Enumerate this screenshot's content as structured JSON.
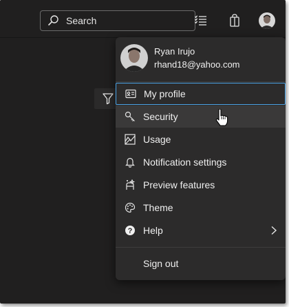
{
  "topbar": {
    "search_placeholder": "Search",
    "icons": [
      "search-icon",
      "list-icon",
      "bag-icon",
      "avatar"
    ]
  },
  "profile": {
    "name": "Ryan Irujo",
    "email": "rhand18@yahoo.com"
  },
  "menu": {
    "items": [
      {
        "label": "My profile",
        "icon": "contact-card-icon"
      },
      {
        "label": "Security",
        "icon": "key-icon"
      },
      {
        "label": "Usage",
        "icon": "usage-icon"
      },
      {
        "label": "Notification settings",
        "icon": "bell-icon"
      },
      {
        "label": "Preview features",
        "icon": "preview-icon"
      },
      {
        "label": "Theme",
        "icon": "palette-icon"
      },
      {
        "label": "Help",
        "icon": "help-icon"
      }
    ],
    "signout_label": "Sign out"
  },
  "colors": {
    "background": "#201f1f",
    "menu_background": "#2c2b2b",
    "focus_border": "#4aa3e6",
    "text": "#f0f0f0"
  }
}
